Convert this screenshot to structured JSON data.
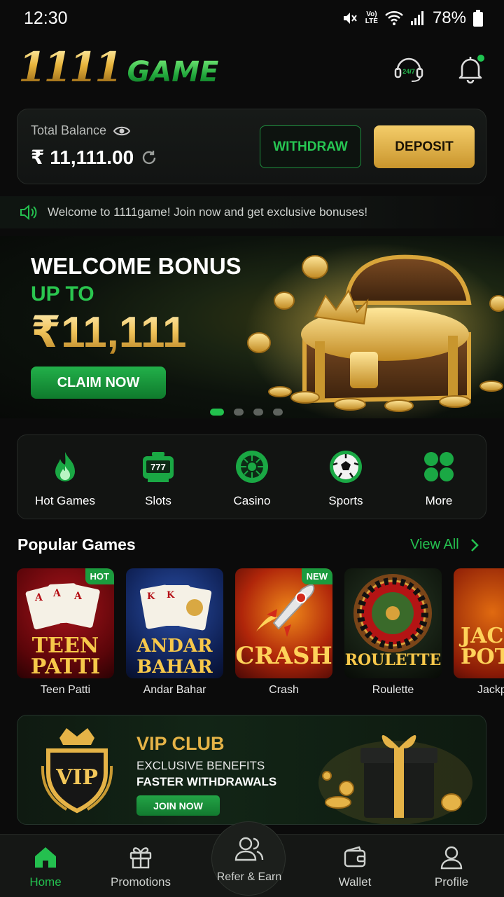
{
  "status_bar": {
    "time": "12:30",
    "network": "Vo) LTE",
    "battery": "78%"
  },
  "header": {
    "logo_digits": "1111",
    "logo_word": "GAME",
    "support_label": "24/7"
  },
  "balance": {
    "label": "Total Balance",
    "amount": "₹ 11,111.00",
    "withdraw_label": "WITHDRAW",
    "deposit_label": "DEPOSIT"
  },
  "marquee": {
    "text": "Welcome to 1111game! Join now and get exclusive bonuses!"
  },
  "banner": {
    "title": "WELCOME BONUS",
    "subtitle": "UP TO",
    "amount": "₹11,111",
    "cta": "CLAIM NOW",
    "slides": 4,
    "active_slide": 1
  },
  "categories": [
    {
      "label": "Hot Games",
      "icon": "flame-icon"
    },
    {
      "label": "Slots",
      "icon": "slot-machine-icon"
    },
    {
      "label": "Casino",
      "icon": "roulette-wheel-icon"
    },
    {
      "label": "Sports",
      "icon": "soccer-ball-icon"
    },
    {
      "label": "More",
      "icon": "grid-dots-icon"
    }
  ],
  "popular": {
    "title": "Popular Games",
    "view_all": "View All",
    "games": [
      {
        "name": "Teen Patti",
        "art": "TEEN\nPATTI",
        "badge": "HOT"
      },
      {
        "name": "Andar Bahar",
        "art": "ANDAR\nBAHAR",
        "badge": ""
      },
      {
        "name": "Crash",
        "art": "CRASH",
        "badge": "NEW"
      },
      {
        "name": "Roulette",
        "art": "ROULETTE",
        "badge": ""
      },
      {
        "name": "Jackp",
        "art": "JACK\nPOT",
        "badge": ""
      }
    ]
  },
  "vip": {
    "badge_text": "VIP",
    "title": "VIP CLUB",
    "line1": "EXCLUSIVE BENEFITS",
    "line2": "FASTER WITHDRAWALS",
    "cta": "JOIN NOW"
  },
  "nav": {
    "home": "Home",
    "promotions": "Promotions",
    "refer": "Refer & Earn",
    "wallet": "Wallet",
    "profile": "Profile"
  },
  "colors": {
    "accent_green": "#24c04f",
    "gold": "#e5b347",
    "background": "#0b0b0b"
  }
}
